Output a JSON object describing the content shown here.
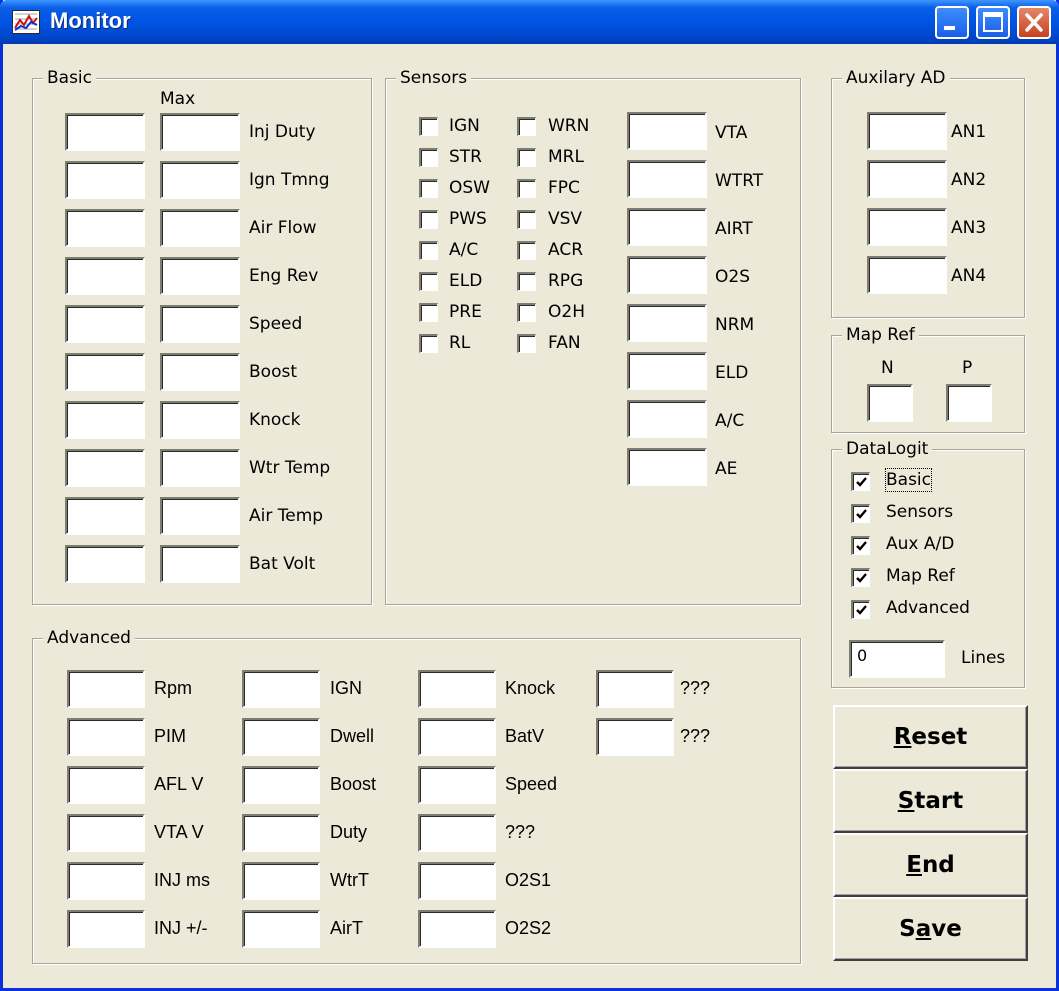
{
  "window": {
    "title": "Monitor"
  },
  "colors": {
    "titlebar": "#0054e3",
    "window_bg": "#ece9d8",
    "close_button": "#c9401f"
  },
  "basic": {
    "legend": "Basic",
    "max_header": "Max",
    "rows": [
      {
        "label": "Inj Duty",
        "value": "",
        "max": ""
      },
      {
        "label": "Ign Tmng",
        "value": "",
        "max": ""
      },
      {
        "label": "Air Flow",
        "value": "",
        "max": ""
      },
      {
        "label": "Eng Rev",
        "value": "",
        "max": ""
      },
      {
        "label": "Speed",
        "value": "",
        "max": ""
      },
      {
        "label": "Boost",
        "value": "",
        "max": ""
      },
      {
        "label": "Knock",
        "value": "",
        "max": ""
      },
      {
        "label": "Wtr Temp",
        "value": "",
        "max": ""
      },
      {
        "label": "Air Temp",
        "value": "",
        "max": ""
      },
      {
        "label": "Bat Volt",
        "value": "",
        "max": ""
      }
    ]
  },
  "sensors": {
    "legend": "Sensors",
    "col1": [
      {
        "label": "IGN",
        "checked": false
      },
      {
        "label": "STR",
        "checked": false
      },
      {
        "label": "OSW",
        "checked": false
      },
      {
        "label": "PWS",
        "checked": false
      },
      {
        "label": "A/C",
        "checked": false
      },
      {
        "label": "ELD",
        "checked": false
      },
      {
        "label": "PRE",
        "checked": false
      },
      {
        "label": "RL",
        "checked": false
      }
    ],
    "col2": [
      {
        "label": "WRN",
        "checked": false
      },
      {
        "label": "MRL",
        "checked": false
      },
      {
        "label": "FPC",
        "checked": false
      },
      {
        "label": "VSV",
        "checked": false
      },
      {
        "label": "ACR",
        "checked": false
      },
      {
        "label": "RPG",
        "checked": false
      },
      {
        "label": "O2H",
        "checked": false
      },
      {
        "label": "FAN",
        "checked": false
      }
    ],
    "fields": [
      {
        "label": "VTA",
        "value": ""
      },
      {
        "label": "WTRT",
        "value": ""
      },
      {
        "label": "AIRT",
        "value": ""
      },
      {
        "label": "O2S",
        "value": ""
      },
      {
        "label": "NRM",
        "value": ""
      },
      {
        "label": "ELD",
        "value": ""
      },
      {
        "label": "A/C",
        "value": ""
      },
      {
        "label": "AE",
        "value": ""
      }
    ]
  },
  "aux": {
    "legend": "Auxilary AD",
    "rows": [
      {
        "label": "AN1",
        "value": ""
      },
      {
        "label": "AN2",
        "value": ""
      },
      {
        "label": "AN3",
        "value": ""
      },
      {
        "label": "AN4",
        "value": ""
      }
    ]
  },
  "mapref": {
    "legend": "Map Ref",
    "n_label": "N",
    "p_label": "P",
    "n_value": "",
    "p_value": ""
  },
  "datalogit": {
    "legend": "DataLogit",
    "items": [
      {
        "label": "Basic",
        "checked": true
      },
      {
        "label": "Sensors",
        "checked": true
      },
      {
        "label": "Aux A/D",
        "checked": true
      },
      {
        "label": "Map Ref",
        "checked": true
      },
      {
        "label": "Advanced",
        "checked": true
      }
    ],
    "lines_value": "0",
    "lines_label": "Lines"
  },
  "advanced": {
    "legend": "Advanced",
    "col1": [
      {
        "label": "Rpm",
        "value": ""
      },
      {
        "label": "PIM",
        "value": ""
      },
      {
        "label": "AFL V",
        "value": ""
      },
      {
        "label": "VTA V",
        "value": ""
      },
      {
        "label": "INJ ms",
        "value": ""
      },
      {
        "label": "INJ +/-",
        "value": ""
      }
    ],
    "col2": [
      {
        "label": "IGN",
        "value": ""
      },
      {
        "label": "Dwell",
        "value": ""
      },
      {
        "label": "Boost",
        "value": ""
      },
      {
        "label": "Duty",
        "value": ""
      },
      {
        "label": "WtrT",
        "value": ""
      },
      {
        "label": "AirT",
        "value": ""
      }
    ],
    "col3": [
      {
        "label": "Knock",
        "value": ""
      },
      {
        "label": "BatV",
        "value": ""
      },
      {
        "label": "Speed",
        "value": ""
      },
      {
        "label": "???",
        "value": ""
      },
      {
        "label": "O2S1",
        "value": ""
      },
      {
        "label": "O2S2",
        "value": ""
      }
    ],
    "col4": [
      {
        "label": "???",
        "value": ""
      },
      {
        "label": "???",
        "value": ""
      }
    ]
  },
  "buttons": {
    "reset": {
      "pre": "",
      "accel": "R",
      "post": "eset"
    },
    "start": {
      "pre": "",
      "accel": "S",
      "post": "tart"
    },
    "end": {
      "pre": "",
      "accel": "E",
      "post": "nd"
    },
    "save": {
      "pre": "S",
      "accel": "a",
      "post": "ve"
    }
  }
}
